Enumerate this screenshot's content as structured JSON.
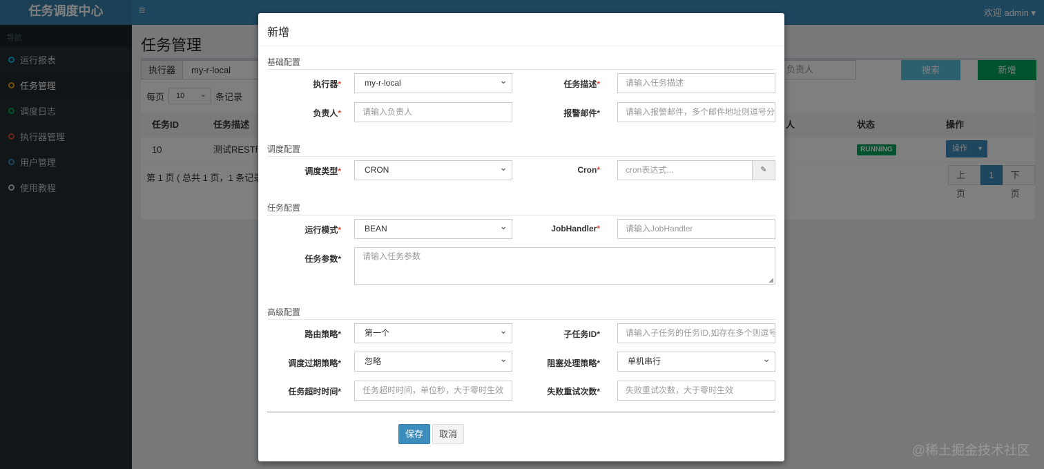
{
  "app": {
    "logo": "任务调度中心",
    "menu_icon": "≡",
    "user_menu": "欢迎 admin ▾"
  },
  "sidebar": {
    "header": "导航",
    "items": [
      {
        "label": "运行报表",
        "color": "#00c0ef"
      },
      {
        "label": "任务管理",
        "color": "#f39c12"
      },
      {
        "label": "调度日志",
        "color": "#00a65a"
      },
      {
        "label": "执行器管理",
        "color": "#dd4b39"
      },
      {
        "label": "用户管理",
        "color": "#3c8dbc"
      },
      {
        "label": "使用教程",
        "color": "#d2d6de"
      }
    ]
  },
  "main": {
    "title": "任务管理",
    "executor_label": "执行器",
    "executor_value": "my-r-local",
    "author_search_placeholder": "负责人",
    "search_button": "搜索",
    "add_button": "新增",
    "per_page_prefix": "每页",
    "per_page_value": "10",
    "per_page_suffix": "条记录",
    "table": {
      "headers": [
        "任务ID",
        "任务描述",
        "人",
        "状态",
        "操作"
      ],
      "rows": [
        {
          "id": "10",
          "desc": "测试RESTfu",
          "status": "RUNNING",
          "op": "操作"
        }
      ]
    },
    "pagination_info": "第 1 页 ( 总共 1 页，1 条记录 )",
    "pagination": {
      "prev": "上页",
      "current": "1",
      "next": "下页"
    }
  },
  "modal": {
    "title": "新增",
    "sections": {
      "basic": "基础配置",
      "schedule": "调度配置",
      "job": "任务配置",
      "advanced": "高级配置"
    },
    "fields": {
      "executor": {
        "label": "执行器",
        "value": "my-r-local"
      },
      "job_desc": {
        "label": "任务描述",
        "placeholder": "请输入任务描述"
      },
      "author": {
        "label": "负责人",
        "placeholder": "请输入负责人"
      },
      "alarm_email": {
        "label": "报警邮件",
        "placeholder": "请输入报警邮件，多个邮件地址则逗号分隔"
      },
      "schedule_type": {
        "label": "调度类型",
        "value": "CRON"
      },
      "cron": {
        "label": "Cron",
        "placeholder": "cron表达式..."
      },
      "glue_type": {
        "label": "运行模式",
        "value": "BEAN"
      },
      "job_handler": {
        "label": "JobHandler",
        "placeholder": "请输入JobHandler"
      },
      "job_param": {
        "label": "任务参数",
        "placeholder": "请输入任务参数"
      },
      "route_strategy": {
        "label": "路由策略",
        "value": "第一个"
      },
      "child_job_id": {
        "label": "子任务ID",
        "placeholder": "请输入子任务的任务ID,如存在多个则逗号分隔"
      },
      "misfire_strategy": {
        "label": "调度过期策略",
        "value": "忽略"
      },
      "block_strategy": {
        "label": "阻塞处理策略",
        "value": "单机串行"
      },
      "timeout": {
        "label": "任务超时时间",
        "placeholder": "任务超时时间，单位秒，大于零时生效"
      },
      "fail_retry": {
        "label": "失败重试次数",
        "placeholder": "失败重试次数，大于零时生效"
      }
    },
    "save_button": "保存",
    "cancel_button": "取消"
  },
  "watermark": "@稀土掘金技术社区"
}
